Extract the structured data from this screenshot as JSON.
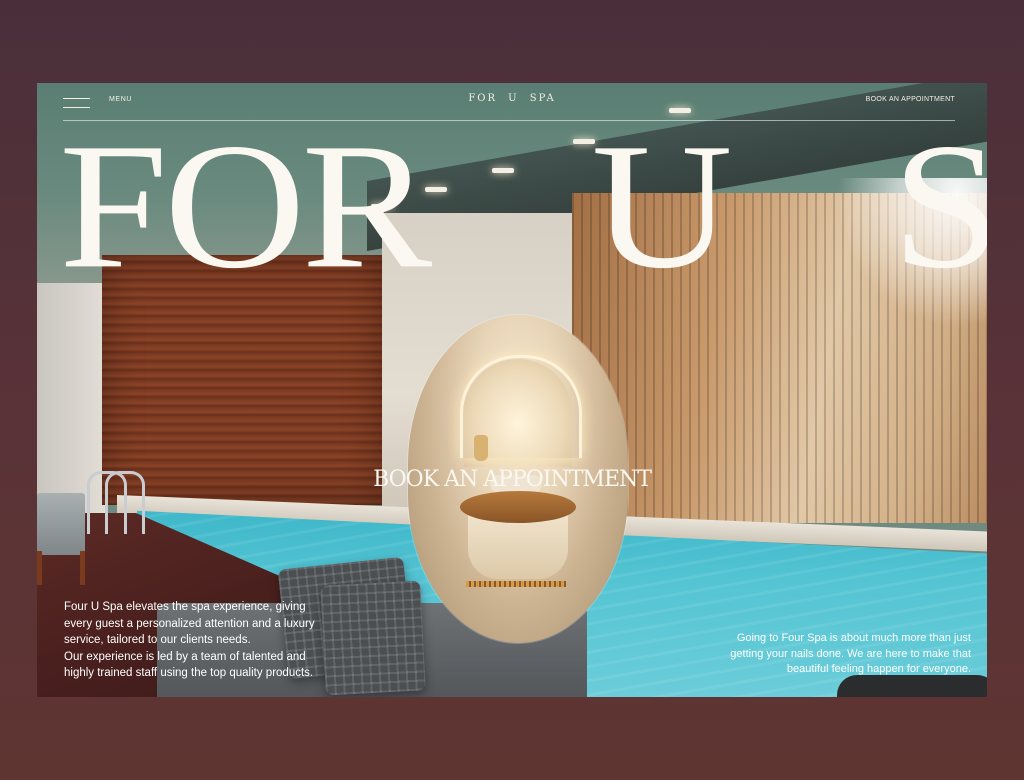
{
  "header": {
    "menu_label": "MENU",
    "logo": "FOR U SPA",
    "book_link": "BOOK AN APPOINTMENT"
  },
  "hero": {
    "title": "FOR U SPA",
    "cta": "BOOK AN APPOINTMENT"
  },
  "about": {
    "left_paragraph_1": "Four U Spa elevates the spa experience, giving every guest a personalized attention and a luxury service, tailored to our clients needs.",
    "left_paragraph_2": "Our experience is led by a team of talented and highly trained staff using the top quality products.",
    "right_paragraph": "Going to Four Spa is about much more than just getting your nails done. We are here to make that beautiful feeling happen for everyone."
  },
  "icons": {
    "menu": "hamburger-icon"
  },
  "colors": {
    "page_background": "#4a2f3a",
    "text_light": "#fbf8f2",
    "pool": "#54c4d3",
    "wood": "#7b3a22"
  }
}
